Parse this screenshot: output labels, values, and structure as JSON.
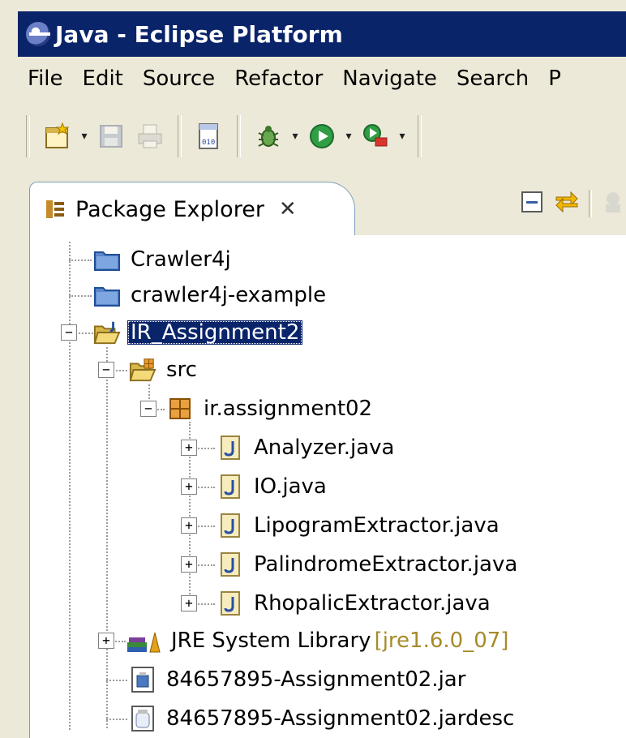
{
  "window": {
    "title": "Java - Eclipse Platform"
  },
  "menu": [
    "File",
    "Edit",
    "Source",
    "Refactor",
    "Navigate",
    "Search",
    "P"
  ],
  "toolbar": {
    "buttons": [
      "new-wizard-icon",
      "save-icon",
      "print-icon",
      "open-type-icon",
      "debug-icon",
      "run-icon",
      "external-tools-icon"
    ]
  },
  "panel": {
    "tab_label": "Package Explorer",
    "tab_close": "✕"
  },
  "tree": {
    "items": [
      {
        "label": "Crawler4j"
      },
      {
        "label": "crawler4j-example"
      },
      {
        "label": "IR_Assignment2"
      },
      {
        "label": "src"
      },
      {
        "label": "ir.assignment02"
      },
      {
        "label": "Analyzer.java"
      },
      {
        "label": "IO.java"
      },
      {
        "label": "LipogramExtractor.java"
      },
      {
        "label": "PalindromeExtractor.java"
      },
      {
        "label": "RhopalicExtractor.java"
      },
      {
        "label": "JRE System Library",
        "decoration": "[jre1.6.0_07]"
      },
      {
        "label": "84657895-Assignment02.jar"
      },
      {
        "label": "84657895-Assignment02.jardesc"
      }
    ]
  },
  "colors": {
    "selection": "#0a246a",
    "titlebar": "#0a246a",
    "decoration": "#a78a2a"
  }
}
